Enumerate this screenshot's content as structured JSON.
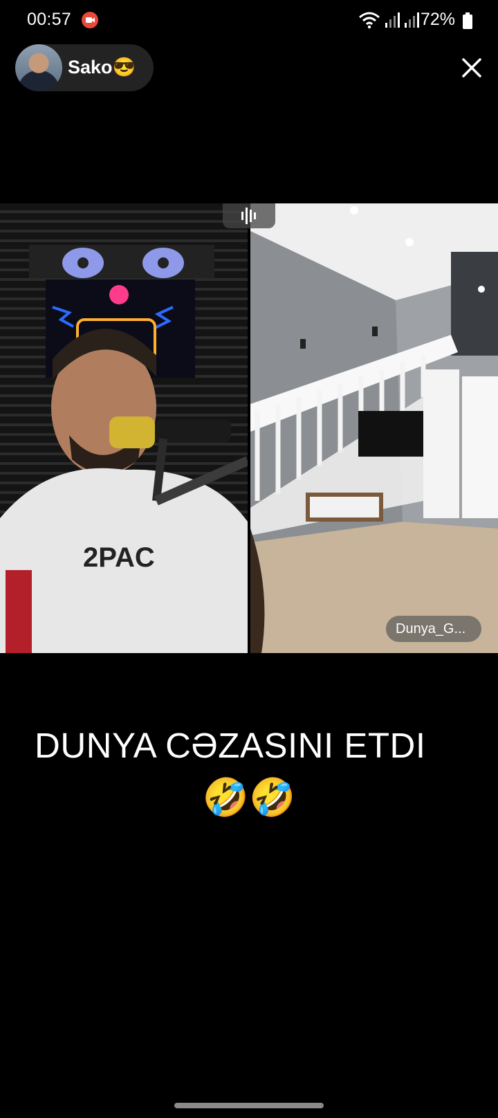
{
  "status_bar": {
    "time": "00:57",
    "battery": "72%",
    "icons": [
      "screen-record-icon",
      "wifi-icon",
      "signal-icon",
      "signal-icon",
      "battery-icon"
    ]
  },
  "host": {
    "name": "Sako😎",
    "avatar": "avatar"
  },
  "close": {
    "icon": "close-icon"
  },
  "video": {
    "guest_name": "Dunya_G...",
    "audio_icon": "audio-waveform-icon"
  },
  "caption": {
    "line1": "DUNYA CƏZASINI  ETDI",
    "line2": "🤣🤣"
  },
  "colors": {
    "background": "#000000",
    "record_badge": "#e8493a"
  }
}
